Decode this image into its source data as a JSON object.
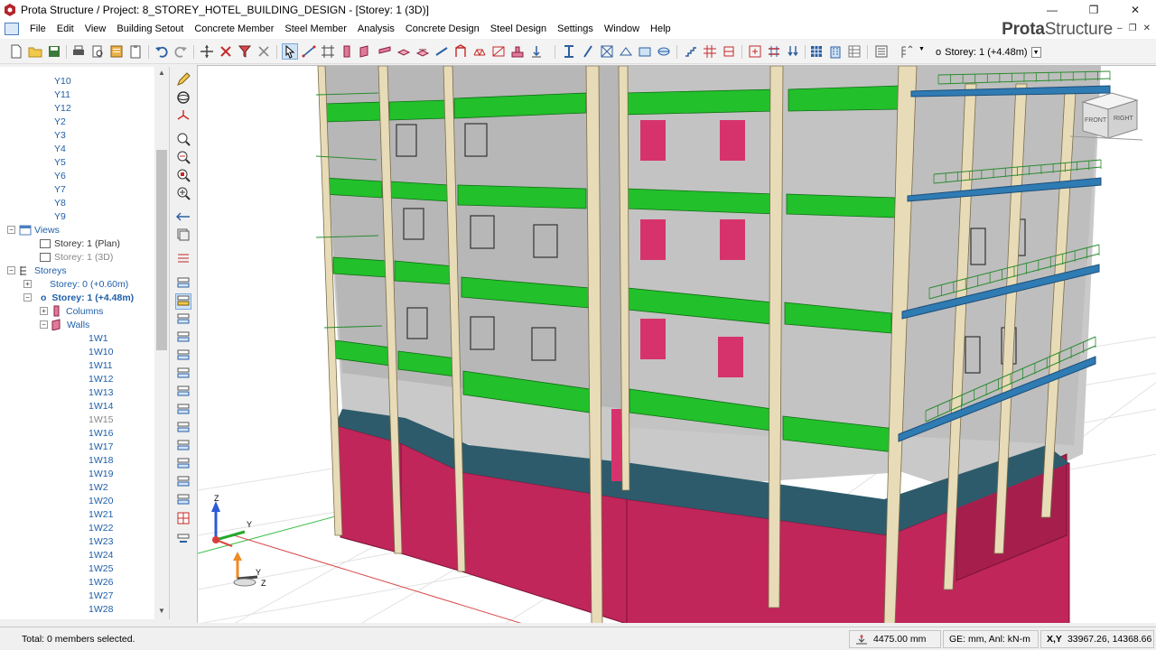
{
  "window": {
    "title": "Prota Structure / Project: 8_STOREY_HOTEL_BUILDING_DESIGN - [Storey: 1 (3D)]",
    "minimize": "—",
    "restore": "❐",
    "close": "✕"
  },
  "menu": {
    "items": [
      "File",
      "Edit",
      "View",
      "Building Setout",
      "Concrete Member",
      "Steel Member",
      "Analysis",
      "Concrete Design",
      "Steel Design",
      "Settings",
      "Window",
      "Help"
    ]
  },
  "brand": {
    "prefix": "Prota",
    "suffix": "Structure"
  },
  "mdi": {
    "minimize": "‒",
    "restore": "❐",
    "close": "✕"
  },
  "toolbar": {
    "storey_combo": "Storey: 1 (+4.48m)",
    "storey_marker": "o"
  },
  "tree": {
    "axis_items": [
      "Y10",
      "Y11",
      "Y12",
      "Y2",
      "Y3",
      "Y4",
      "Y5",
      "Y6",
      "Y7",
      "Y8",
      "Y9"
    ],
    "views_label": "Views",
    "view_items": [
      "Storey: 1 (Plan)",
      "Storey: 1 (3D)"
    ],
    "storeys_label": "Storeys",
    "storey_items": [
      "Storey: 0 (+0.60m)",
      "Storey: 1 (+4.48m)"
    ],
    "columns_label": "Columns",
    "walls_label": "Walls",
    "wall_items": [
      "1W1",
      "1W10",
      "1W11",
      "1W12",
      "1W13",
      "1W14",
      "1W15",
      "1W16",
      "1W17",
      "1W18",
      "1W19",
      "1W2",
      "1W20",
      "1W21",
      "1W22",
      "1W23",
      "1W24",
      "1W25",
      "1W26",
      "1W27",
      "1W28"
    ]
  },
  "viewport": {
    "cube_front": "FRONT",
    "cube_right": "RIGHT",
    "axis_z": "Z",
    "axis_y": "Y",
    "axis_z2": "Z",
    "axis_y2": "Y"
  },
  "status": {
    "selection": "Total: 0 members selected.",
    "elevation": "4475.00 mm",
    "units": "GE: mm,  Anl: kN-m",
    "xy_label": "X,Y",
    "coords": "33967.26, 14368.66"
  },
  "colors": {
    "slab_green": "#22c02b",
    "wall_crimson": "#c0265a",
    "column": "#e8dcb8",
    "floor_teal": "#2d5b6b",
    "balcony_blue": "#2f7bb3",
    "tree_text": "#1f5fa8"
  }
}
